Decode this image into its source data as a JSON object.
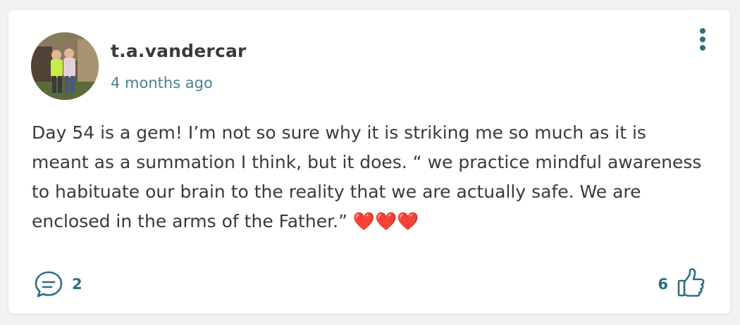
{
  "post": {
    "author": "t.a.vandercar",
    "timestamp": "4 months ago",
    "body": "Day 54 is a gem! I’m not so sure why it is striking me so much as it is meant as a summation I think, but it does. “ we practice mindful awareness to habituate our brain to the reality that we are actually safe. We are enclosed in the arms of the Father.” ❤️❤️❤️",
    "comment_count": "2",
    "like_count": "6"
  },
  "icons": {
    "more": "more-vertical-icon",
    "comment": "comment-bubble-icon",
    "like": "thumbs-up-icon"
  },
  "colors": {
    "accent": "#2f6e80",
    "timestamp": "#4a7f8e",
    "text": "#3a3a3a",
    "card": "#ffffff",
    "background": "#f2f2f2"
  }
}
